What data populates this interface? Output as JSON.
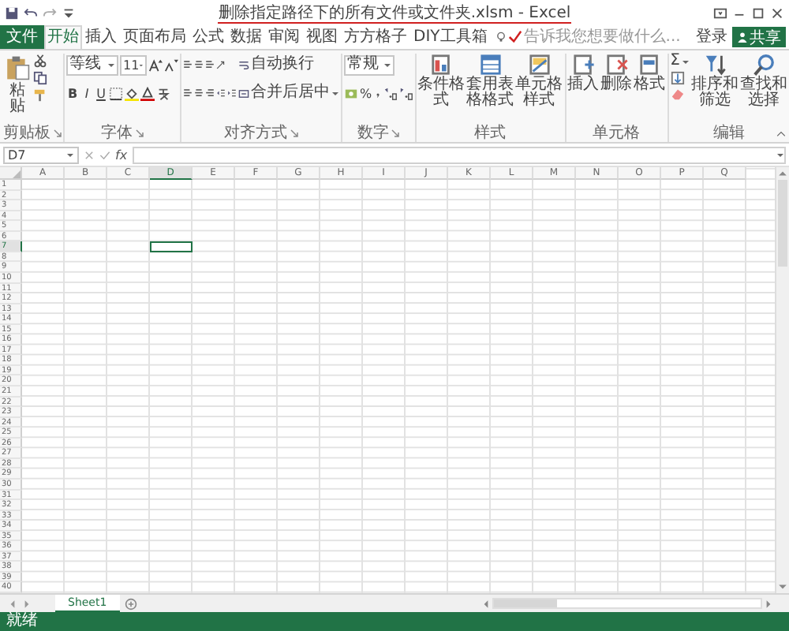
{
  "window": {
    "title": "删除指定路径下的所有文件或文件夹.xlsm - Excel"
  },
  "tabs": [
    {
      "label": "文件",
      "kind": "file",
      "selected": false
    },
    {
      "label": "开始",
      "kind": "tab",
      "selected": true
    },
    {
      "label": "插入",
      "kind": "tab",
      "selected": false
    },
    {
      "label": "页面布局",
      "kind": "tab",
      "selected": false
    },
    {
      "label": "公式",
      "kind": "tab",
      "selected": false
    },
    {
      "label": "数据",
      "kind": "tab",
      "selected": false
    },
    {
      "label": "审阅",
      "kind": "tab",
      "selected": false
    },
    {
      "label": "视图",
      "kind": "tab",
      "selected": false
    },
    {
      "label": "方方格子",
      "kind": "tab",
      "selected": false
    },
    {
      "label": "DIY工具箱",
      "kind": "tab",
      "selected": false
    }
  ],
  "tell_me": {
    "placeholder": "告诉我您想要做什么..."
  },
  "account": {
    "sign_in": "登录",
    "share": "共享"
  },
  "ribbon": [
    {
      "kind": "clipboard",
      "label": "剪贴板",
      "paste": "粘贴"
    },
    {
      "kind": "font",
      "label": "字体",
      "font_name": "等线",
      "font_size": "11",
      "bold": "B",
      "italic": "I",
      "underline": "U"
    },
    {
      "kind": "alignment",
      "label": "对齐方式",
      "wrap": "自动换行",
      "merge": "合并后居中"
    },
    {
      "kind": "number",
      "label": "数字",
      "format": "常规",
      "percent": "%"
    },
    {
      "kind": "styles",
      "label": "样式",
      "buttons": [
        "条件格式",
        "套用表格格式",
        "单元格样式"
      ]
    },
    {
      "kind": "cells",
      "label": "单元格",
      "buttons": [
        "插入",
        "删除",
        "格式"
      ]
    },
    {
      "kind": "editing",
      "label": "编辑",
      "autosum": "Σ",
      "buttons": [
        "排序和筛选",
        "查找和选择"
      ]
    }
  ],
  "formula_bar": {
    "name_box": "D7",
    "function_label": "fx"
  },
  "columns": [
    {
      "label": "A",
      "selected": false
    },
    {
      "label": "B",
      "selected": false
    },
    {
      "label": "C",
      "selected": false
    },
    {
      "label": "D",
      "selected": true
    },
    {
      "label": "E",
      "selected": false
    },
    {
      "label": "F",
      "selected": false
    },
    {
      "label": "G",
      "selected": false
    },
    {
      "label": "H",
      "selected": false
    },
    {
      "label": "I",
      "selected": false
    },
    {
      "label": "J",
      "selected": false
    },
    {
      "label": "K",
      "selected": false
    },
    {
      "label": "L",
      "selected": false
    },
    {
      "label": "M",
      "selected": false
    },
    {
      "label": "N",
      "selected": false
    },
    {
      "label": "O",
      "selected": false
    },
    {
      "label": "P",
      "selected": false
    },
    {
      "label": "Q",
      "selected": false
    }
  ],
  "rows": [
    {
      "label": "1",
      "selected": false
    },
    {
      "label": "2",
      "selected": false
    },
    {
      "label": "3",
      "selected": false
    },
    {
      "label": "4",
      "selected": false
    },
    {
      "label": "5",
      "selected": false
    },
    {
      "label": "6",
      "selected": false
    },
    {
      "label": "7",
      "selected": true
    },
    {
      "label": "8",
      "selected": false
    },
    {
      "label": "9",
      "selected": false
    },
    {
      "label": "10",
      "selected": false
    },
    {
      "label": "11",
      "selected": false
    },
    {
      "label": "12",
      "selected": false
    },
    {
      "label": "13",
      "selected": false
    },
    {
      "label": "14",
      "selected": false
    },
    {
      "label": "15",
      "selected": false
    },
    {
      "label": "16",
      "selected": false
    },
    {
      "label": "17",
      "selected": false
    },
    {
      "label": "18",
      "selected": false
    },
    {
      "label": "19",
      "selected": false
    },
    {
      "label": "20",
      "selected": false
    },
    {
      "label": "21",
      "selected": false
    },
    {
      "label": "22",
      "selected": false
    },
    {
      "label": "23",
      "selected": false
    },
    {
      "label": "24",
      "selected": false
    },
    {
      "label": "25",
      "selected": false
    },
    {
      "label": "26",
      "selected": false
    },
    {
      "label": "27",
      "selected": false
    },
    {
      "label": "28",
      "selected": false
    },
    {
      "label": "29",
      "selected": false
    },
    {
      "label": "30",
      "selected": false
    },
    {
      "label": "31",
      "selected": false
    },
    {
      "label": "32",
      "selected": false
    },
    {
      "label": "33",
      "selected": false
    },
    {
      "label": "34",
      "selected": false
    },
    {
      "label": "35",
      "selected": false
    },
    {
      "label": "36",
      "selected": false
    },
    {
      "label": "37",
      "selected": false
    },
    {
      "label": "38",
      "selected": false
    },
    {
      "label": "39",
      "selected": false
    },
    {
      "label": "40",
      "selected": false
    }
  ],
  "sheets": [
    {
      "label": "Sheet1",
      "selected": true
    }
  ],
  "status_bar": {
    "text": "就绪"
  }
}
